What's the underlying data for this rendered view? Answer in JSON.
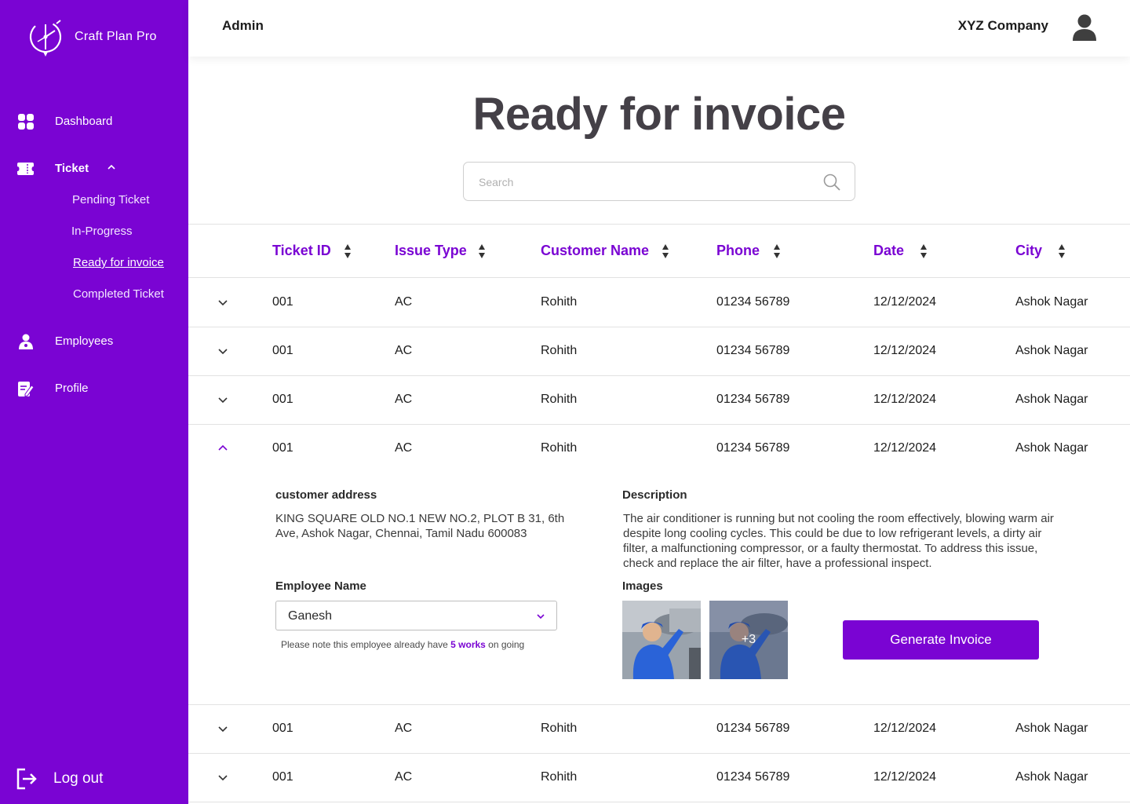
{
  "app": {
    "name": "Craft Plan Pro"
  },
  "sidebar": {
    "items": [
      {
        "label": "Dashboard",
        "icon": "dashboard-grid-icon"
      },
      {
        "label": "Ticket",
        "icon": "ticket-icon"
      },
      {
        "label": "Employees",
        "icon": "employee-icon"
      },
      {
        "label": "Profile",
        "icon": "profile-edit-icon"
      }
    ],
    "ticket_sub": [
      "Pending Ticket",
      "In-Progress",
      "Ready for invoice",
      "Completed Ticket"
    ],
    "logout": "Log out"
  },
  "header": {
    "role": "Admin",
    "company": "XYZ Company"
  },
  "page": {
    "title": "Ready for invoice"
  },
  "search": {
    "placeholder": "Search",
    "value": ""
  },
  "table": {
    "columns": [
      "Ticket ID",
      "Issue Type",
      "Customer Name",
      "Phone",
      "Date",
      "City"
    ],
    "rows": [
      {
        "id": "001",
        "issue": "AC",
        "customer": "Rohith",
        "phone": "01234 56789",
        "date": "12/12/2024",
        "city": "Ashok Nagar"
      },
      {
        "id": "001",
        "issue": "AC",
        "customer": "Rohith",
        "phone": "01234 56789",
        "date": "12/12/2024",
        "city": "Ashok Nagar"
      },
      {
        "id": "001",
        "issue": "AC",
        "customer": "Rohith",
        "phone": "01234 56789",
        "date": "12/12/2024",
        "city": "Ashok Nagar"
      },
      {
        "id": "001",
        "issue": "AC",
        "customer": "Rohith",
        "phone": "01234 56789",
        "date": "12/12/2024",
        "city": "Ashok Nagar"
      },
      {
        "id": "001",
        "issue": "AC",
        "customer": "Rohith",
        "phone": "01234 56789",
        "date": "12/12/2024",
        "city": "Ashok Nagar"
      },
      {
        "id": "001",
        "issue": "AC",
        "customer": "Rohith",
        "phone": "01234 56789",
        "date": "12/12/2024",
        "city": "Ashok Nagar"
      }
    ]
  },
  "detail": {
    "address_label": "customer address",
    "address_line1": "KING SQUARE OLD NO.1 NEW NO.2, PLOT B 31, 6th",
    "address_line2": "Ave, Ashok Nagar, Chennai, Tamil Nadu 600083",
    "description_label": "Description",
    "description_lines": [
      "The air conditioner is running but not cooling the room effectively, blowing warm air",
      "despite long cooling cycles. This could be due to low refrigerant levels, a dirty air",
      "filter, a malfunctioning compressor, or a faulty thermostat. To address this issue,",
      "check and replace the air filter, have a professional inspect."
    ],
    "employee_label": "Employee Name",
    "employee_value": "Ganesh",
    "note_prefix": "Please note this employee already have ",
    "note_bold": "5 works",
    "note_suffix": " on going",
    "images_label": "Images",
    "images_more": "+3",
    "generate_button": "Generate Invoice"
  },
  "colors": {
    "brand": "#7a04d3",
    "title": "#444047",
    "border": "#e2e2e2"
  }
}
